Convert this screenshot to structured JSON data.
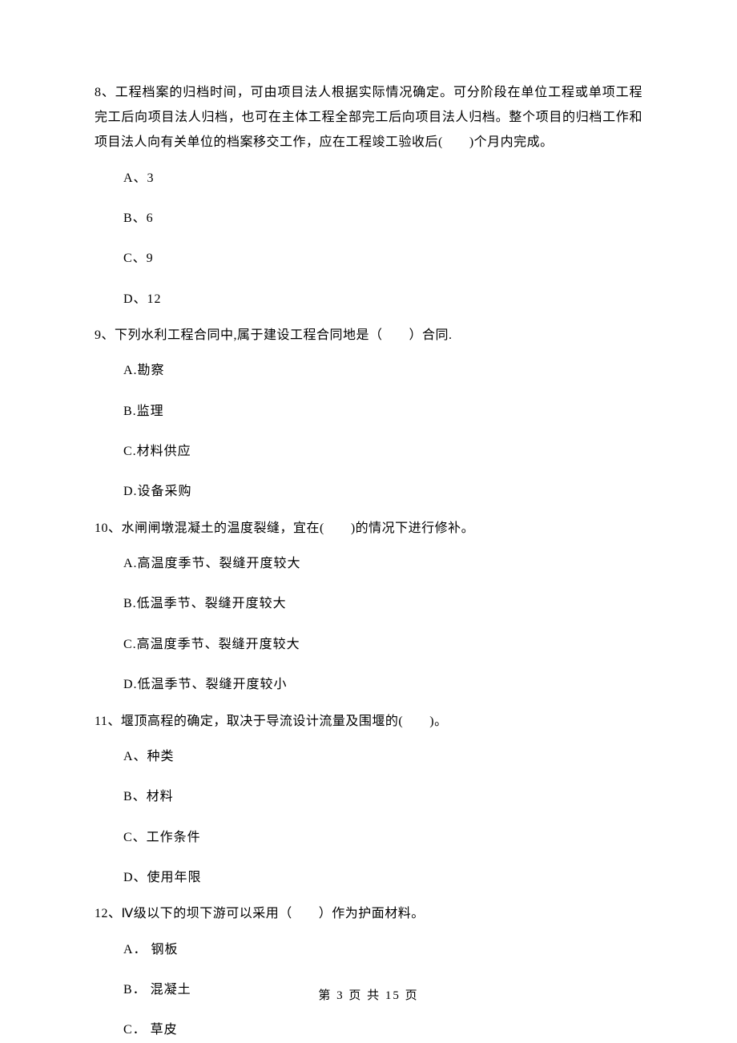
{
  "questions": [
    {
      "number": "8、",
      "text": "工程档案的归档时间，可由项目法人根据实际情况确定。可分阶段在单位工程或单项工程完工后向项目法人归档，也可在主体工程全部完工后向项目法人归档。整个项目的归档工作和项目法人向有关单位的档案移交工作，应在工程竣工验收后(　　)个月内完成。",
      "options": [
        "A、3",
        "B、6",
        "C、9",
        "D、12"
      ]
    },
    {
      "number": "9、",
      "text": "下列水利工程合同中,属于建设工程合同地是（　　）合同.",
      "options": [
        "A.勘察",
        "B.监理",
        "C.材料供应",
        "D.设备采购"
      ]
    },
    {
      "number": "10、",
      "text": "水闸闸墩混凝土的温度裂缝，宜在(　　)的情况下进行修补。",
      "options": [
        "A.高温度季节、裂缝开度较大",
        "B.低温季节、裂缝开度较大",
        "C.高温度季节、裂缝开度较大",
        "D.低温季节、裂缝开度较小"
      ]
    },
    {
      "number": "11、",
      "text": "堰顶高程的确定，取决于导流设计流量及围堰的(　　)。",
      "options": [
        "A、种类",
        "B、材料",
        "C、工作条件",
        "D、使用年限"
      ]
    },
    {
      "number": "12、",
      "text": "Ⅳ级以下的坝下游可以采用（　　）作为护面材料。",
      "options": [
        "A． 钢板",
        "B． 混凝土",
        "C． 草皮"
      ]
    }
  ],
  "footer": "第 3 页 共 15 页"
}
